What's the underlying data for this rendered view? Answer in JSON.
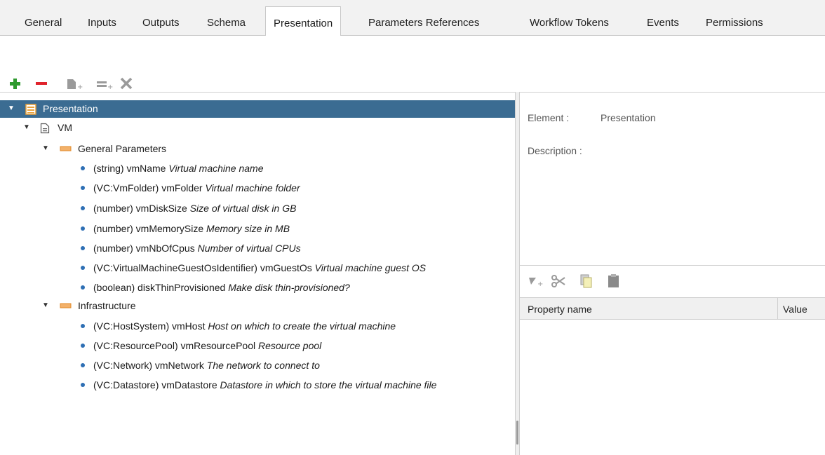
{
  "tabs": [
    {
      "label": "General"
    },
    {
      "label": "Inputs"
    },
    {
      "label": "Outputs"
    },
    {
      "label": "Schema"
    },
    {
      "label": "Presentation",
      "active": true
    },
    {
      "label": "Parameters References"
    },
    {
      "label": "Workflow Tokens"
    },
    {
      "label": "Events"
    },
    {
      "label": "Permissions"
    }
  ],
  "toolbar": {
    "icons": [
      "add-icon",
      "remove-icon",
      "add-step-icon",
      "add-group-icon",
      "delete-icon"
    ],
    "colors": {
      "add": "#2e9a2e",
      "remove": "#e0232c",
      "disabled": "#9a9a9a"
    }
  },
  "tree": {
    "root": "Presentation",
    "step": "VM",
    "groups": [
      {
        "label": "General Parameters",
        "params": [
          {
            "sig": "(string) vmName",
            "desc": "Virtual machine name"
          },
          {
            "sig": "(VC:VmFolder) vmFolder",
            "desc": "Virtual machine folder"
          },
          {
            "sig": "(number) vmDiskSize",
            "desc": "Size of virtual disk in GB"
          },
          {
            "sig": "(number) vmMemorySize",
            "desc": "Memory size in MB"
          },
          {
            "sig": "(number) vmNbOfCpus",
            "desc": "Number of virtual CPUs"
          },
          {
            "sig": "(VC:VirtualMachineGuestOsIdentifier) vmGuestOs",
            "desc": "Virtual machine guest OS"
          },
          {
            "sig": "(boolean) diskThinProvisioned",
            "desc": "Make disk thin-provisioned?"
          }
        ]
      },
      {
        "label": "Infrastructure",
        "params": [
          {
            "sig": "(VC:HostSystem) vmHost",
            "desc": "Host on which to create the virtual machine"
          },
          {
            "sig": "(VC:ResourcePool) vmResourcePool",
            "desc": "Resource pool"
          },
          {
            "sig": "(VC:Network) vmNetwork",
            "desc": "The network to connect to"
          },
          {
            "sig": "(VC:Datastore) vmDatastore",
            "desc": "Datastore in which to store the virtual machine file"
          }
        ]
      }
    ],
    "selected_color": "#3b6c92"
  },
  "details": {
    "element_label": "Element :",
    "element_value": "Presentation",
    "description_label": "Description :"
  },
  "properties": {
    "icons": [
      "add-property-icon",
      "cut-icon",
      "copy-icon",
      "paste-icon"
    ],
    "columns": [
      "Property name",
      "Value"
    ]
  }
}
